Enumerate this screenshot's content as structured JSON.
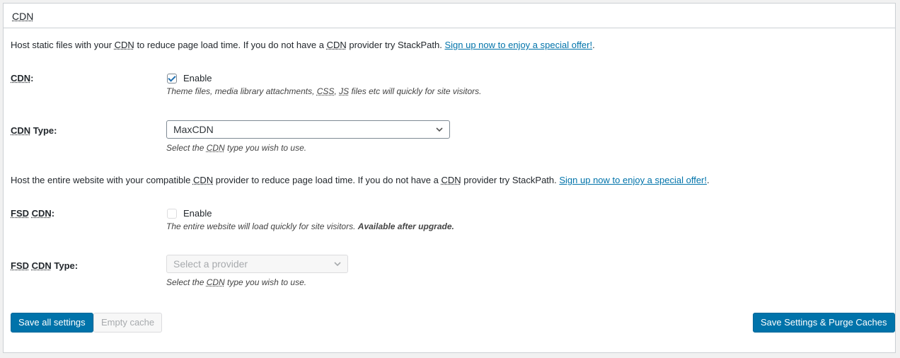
{
  "panel": {
    "title": "CDN"
  },
  "section1": {
    "intro": {
      "part1": "Host static files with your ",
      "cdn1": "CDN",
      "part2": " to reduce page load time. If you do not have a ",
      "cdn2": "CDN",
      "part3": " provider try StackPath. ",
      "link": "Sign up now to enjoy a special offer!",
      "end": "."
    },
    "cdn_field": {
      "label_abbr": "CDN",
      "label_suffix": ":",
      "checkbox_label": "Enable",
      "checked": true,
      "desc_part1": "Theme files, media library attachments, ",
      "desc_css": "CSS",
      "desc_comma": ", ",
      "desc_js": "JS",
      "desc_part2": " files etc will quickly for site visitors."
    },
    "cdn_type": {
      "label_abbr": "CDN",
      "label_suffix": " Type:",
      "selected": "MaxCDN",
      "desc_part1": "Select the ",
      "desc_abbr": "CDN",
      "desc_part2": " type you wish to use."
    }
  },
  "section2": {
    "intro": {
      "part1": "Host the entire website with your compatible ",
      "cdn1": "CDN",
      "part2": " provider to reduce page load time. If you do not have a ",
      "cdn2": "CDN",
      "part3": " provider try StackPath. ",
      "link": "Sign up now to enjoy a special offer!",
      "end": "."
    },
    "fsd_cdn": {
      "label_fsd": "FSD",
      "label_cdn": "CDN",
      "label_suffix": ":",
      "checkbox_label": "Enable",
      "checked": false,
      "desc_part1": "The entire website will load quickly for site visitors. ",
      "desc_bold": "Available after upgrade."
    },
    "fsd_cdn_type": {
      "label_fsd": "FSD",
      "label_cdn": "CDN",
      "label_suffix": " Type:",
      "placeholder": "Select a provider",
      "desc_part1": "Select the ",
      "desc_abbr": "CDN",
      "desc_part2": " type you wish to use."
    }
  },
  "buttons": {
    "save_all": "Save all settings",
    "empty_cache": "Empty cache",
    "save_purge": "Save Settings & Purge Caches"
  },
  "colors": {
    "primary": "#0073aa",
    "link": "#0073aa"
  },
  "icons": {
    "checkbox_check": "check-icon",
    "select_arrow": "chevron-down-icon"
  }
}
